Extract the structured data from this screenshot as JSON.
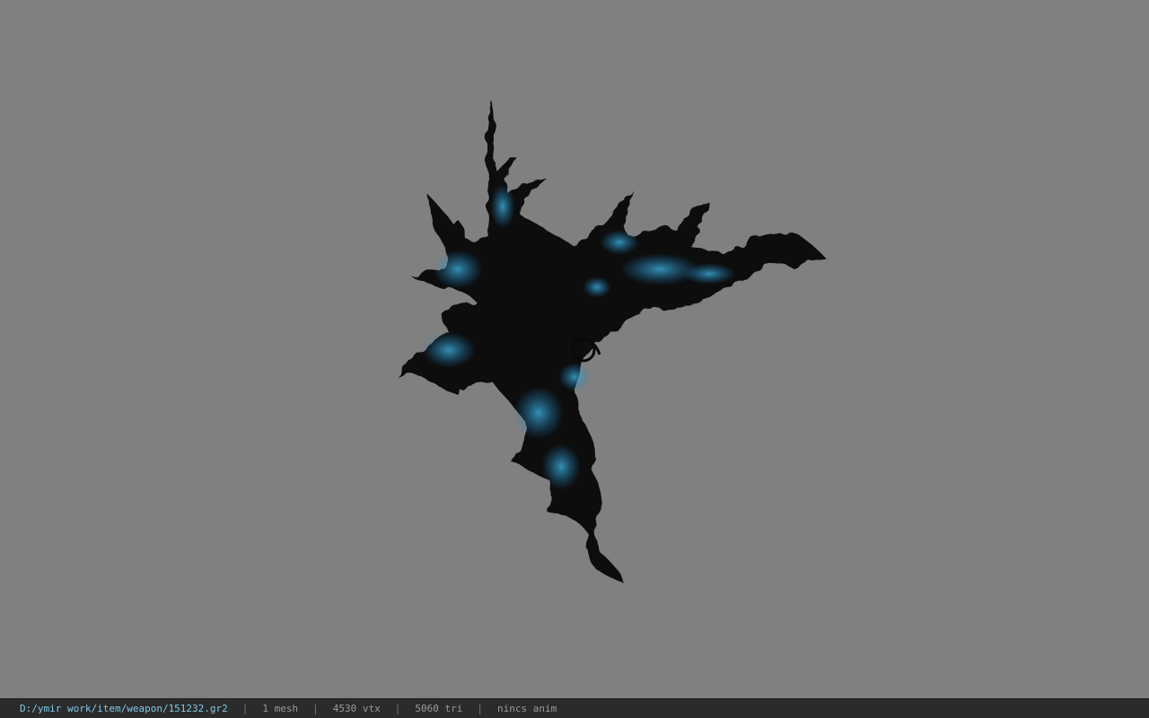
{
  "viewer": {
    "background_color": "#808080",
    "model_colors": {
      "body": "#07090c",
      "glow": "#1e7fbf",
      "glow_bright": "#3fb8e6"
    }
  },
  "statusbar": {
    "file_path": "D:/ymir work/item/weapon/151232.gr2",
    "separator": "|",
    "mesh_count": "1 mesh",
    "vertex_count": "4530 vtx",
    "triangle_count": "5060 tri",
    "anim": "nincs anim"
  }
}
